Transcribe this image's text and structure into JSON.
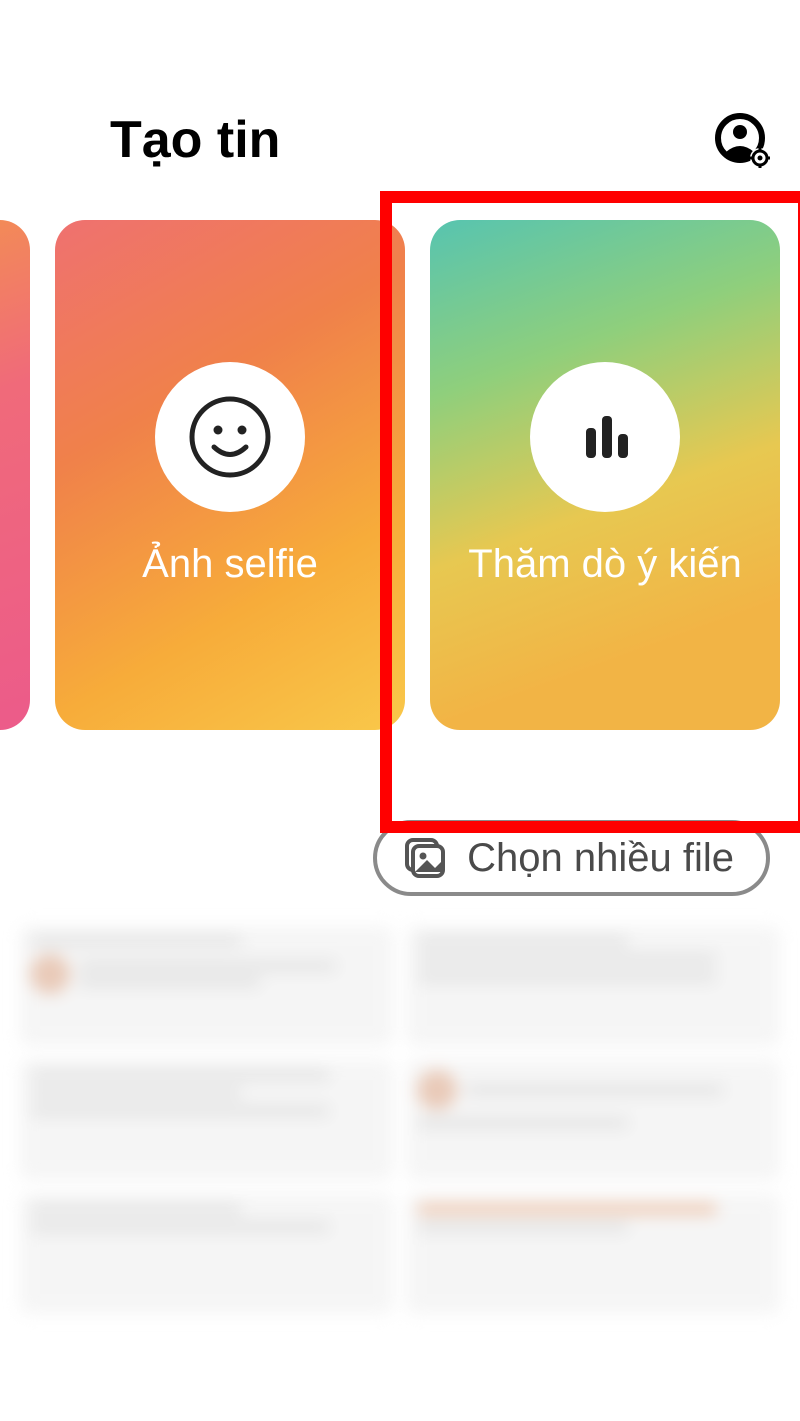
{
  "header": {
    "title": "Tạo tin",
    "settings_icon": "person-gear-icon"
  },
  "cards": {
    "selfie": {
      "label": "Ảnh selfie",
      "icon": "smile-icon"
    },
    "poll": {
      "label": "Thăm dò ý kiến",
      "icon": "poll-bars-icon"
    }
  },
  "select_button": {
    "label": "Chọn nhiều file",
    "icon": "gallery-multi-icon"
  }
}
